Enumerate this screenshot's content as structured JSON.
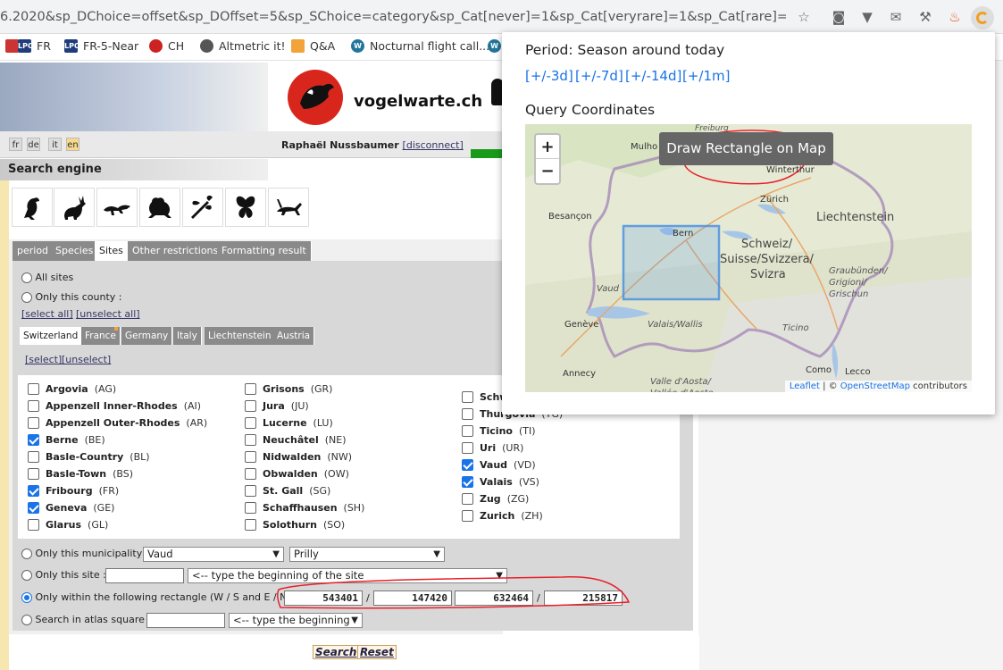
{
  "browser": {
    "url": "6.2020&sp_DChoice=offset&sp_DOffset=5&sp_SChoice=category&sp_Cat[never]=1&sp_Cat[veryrare]=1&sp_Cat[rare]=1&sp_Cat[unusual]=...",
    "bookmarks": [
      "FR",
      "FR-5-Near",
      "CH",
      "Altmetric it!",
      "Q&A",
      "Nocturnal flight call..."
    ]
  },
  "header": {
    "site_name": "vogelwarte.ch",
    "languages": [
      "fr",
      "de",
      "it",
      "en"
    ],
    "user_name": "Raphaël Nussbaumer",
    "disconnect": "[disconnect]",
    "search_title": "Search engine"
  },
  "tabs": [
    "period",
    "Species",
    "Sites",
    "Other restrictions",
    "Formatting result"
  ],
  "sites": {
    "all_sites": "All sites",
    "only_county": "Only this county :",
    "select_all": "[select all]",
    "unselect_all": "[unselect all]",
    "country_tabs": [
      "Switzerland",
      "France",
      "Germany",
      "Italy",
      "Liechtenstein",
      "Austria"
    ],
    "select": "[select]",
    "unselect": "[unselect]",
    "cantons_col1": [
      {
        "name": "Argovia",
        "code": "(AG)",
        "checked": false
      },
      {
        "name": "Appenzell Inner-Rhodes",
        "code": "(AI)",
        "checked": false
      },
      {
        "name": "Appenzell Outer-Rhodes",
        "code": "(AR)",
        "checked": false
      },
      {
        "name": "Berne",
        "code": "(BE)",
        "checked": true
      },
      {
        "name": "Basle-Country",
        "code": "(BL)",
        "checked": false
      },
      {
        "name": "Basle-Town",
        "code": "(BS)",
        "checked": false
      },
      {
        "name": "Fribourg",
        "code": "(FR)",
        "checked": true
      },
      {
        "name": "Geneva",
        "code": "(GE)",
        "checked": true
      },
      {
        "name": "Glarus",
        "code": "(GL)",
        "checked": false
      }
    ],
    "cantons_col2": [
      {
        "name": "Grisons",
        "code": "(GR)",
        "checked": false
      },
      {
        "name": "Jura",
        "code": "(JU)",
        "checked": false
      },
      {
        "name": "Lucerne",
        "code": "(LU)",
        "checked": false
      },
      {
        "name": "Neuchâtel",
        "code": "(NE)",
        "checked": false
      },
      {
        "name": "Nidwalden",
        "code": "(NW)",
        "checked": false
      },
      {
        "name": "Obwalden",
        "code": "(OW)",
        "checked": false
      },
      {
        "name": "St. Gall",
        "code": "(SG)",
        "checked": false
      },
      {
        "name": "Schaffhausen",
        "code": "(SH)",
        "checked": false
      },
      {
        "name": "Solothurn",
        "code": "(SO)",
        "checked": false
      }
    ],
    "cantons_col3": [
      {
        "name": "Schw",
        "code": "",
        "checked": false
      },
      {
        "name": "Thurgovia",
        "code": "(TG)",
        "checked": false
      },
      {
        "name": "Ticino",
        "code": "(TI)",
        "checked": false
      },
      {
        "name": "Uri",
        "code": "(UR)",
        "checked": false
      },
      {
        "name": "Vaud",
        "code": "(VD)",
        "checked": true
      },
      {
        "name": "Valais",
        "code": "(VS)",
        "checked": true
      },
      {
        "name": "Zug",
        "code": "(ZG)",
        "checked": false
      },
      {
        "name": "Zurich",
        "code": "(ZH)",
        "checked": false
      }
    ],
    "only_municipality": "Only this municipality :",
    "municipality_canton": "Vaud",
    "municipality": "Prilly",
    "only_site": "Only this site :",
    "site_placeholder": "<-- type the beginning of the site",
    "only_rectangle": "Only within the following rectangle (W / S and E / N) :",
    "rect_w": "543401",
    "rect_s": "147420",
    "rect_e": "632464",
    "rect_n": "215817",
    "atlas_square": "Search in atlas square :",
    "atlas_placeholder": "<-- type the beginning",
    "search_btn": "Search",
    "reset_btn": "Reset"
  },
  "popup": {
    "period_title": "Period: Season around today",
    "period_links": [
      "[+/-3d]",
      "[+/-7d]",
      "[+/-14d]",
      "[+/1m]"
    ],
    "coords_title": "Query Coordinates",
    "zoom_in": "+",
    "zoom_out": "−",
    "draw_tip": "Draw Rectangle on Map",
    "attribution_leaflet": "Leaflet",
    "attribution_sep": " | © ",
    "attribution_osm": "OpenStreetMap",
    "attribution_suffix": " contributors",
    "map_labels": {
      "mulhouse": "Mulho",
      "friburg": "Freiburg",
      "winterthur": "Winterthur",
      "zurich": "Zürich",
      "besancon": "Besançon",
      "liechtenstein": "Liechtenstein",
      "bern": "Bern",
      "schweiz1": "Schweiz/",
      "schweiz2": "Suisse/Svizzera/",
      "schweiz3": "Svizra",
      "graubunden": "Graubünden/\nGrigioni/\nGrischun",
      "vaud": "Vaud",
      "geneve": "Genève",
      "valais": "Valais/Wallis",
      "ticino": "Ticino",
      "annecy": "Annecy",
      "aosta": "Valle d'Aosta/\nVallée d'Aoste",
      "como": "Como",
      "lecco": "Lecco"
    }
  },
  "colors": {
    "link": "#1a73e8",
    "checkbox": "#1a73e8",
    "annotation": "#e8202a",
    "rectangle": "#4a90e2"
  }
}
